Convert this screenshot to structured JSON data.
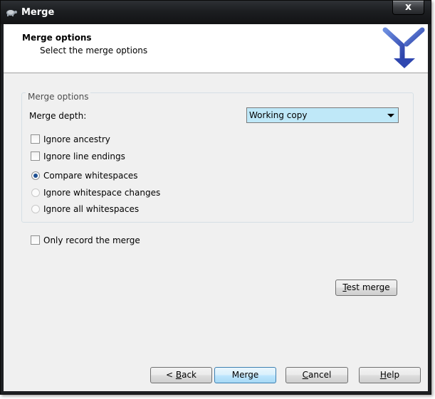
{
  "window": {
    "title": "Merge",
    "close_symbol": "x"
  },
  "header": {
    "title": "Merge options",
    "subtitle": "Select the merge options"
  },
  "group": {
    "legend": "Merge options",
    "merge_depth_label": "Merge depth:",
    "merge_depth_value": "Working copy",
    "ignore_ancestry": "Ignore ancestry",
    "ignore_line_endings": "Ignore line endings",
    "whitespace_options": [
      {
        "label": "Compare whitespaces",
        "selected": true
      },
      {
        "label": "Ignore whitespace changes",
        "selected": false
      },
      {
        "label": "Ignore all whitespaces",
        "selected": false
      }
    ]
  },
  "only_record": "Only record the merge",
  "buttons": {
    "test_merge": {
      "underlined": "T",
      "rest": "est merge"
    },
    "back": {
      "prefix": "< ",
      "underlined": "B",
      "rest": "ack"
    },
    "merge": "Merge",
    "cancel": {
      "underlined": "C",
      "rest": "ancel"
    },
    "help": {
      "underlined": "H",
      "rest": "elp"
    }
  },
  "colors": {
    "dropdown_bg": "#bfe8f8",
    "titlebar": "#1c1e21",
    "default_button": "#bee6fd"
  }
}
